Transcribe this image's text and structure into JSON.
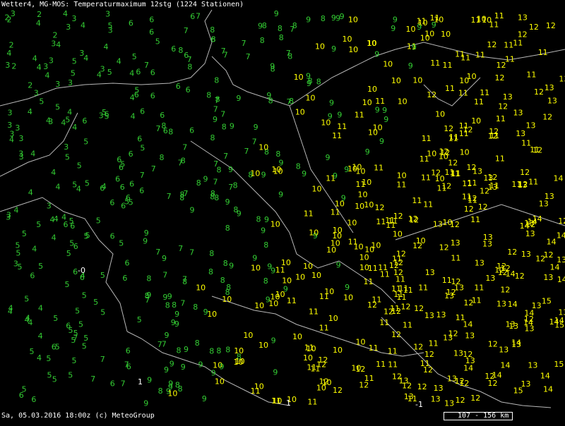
{
  "header": {
    "title": "Wetter4, MG-MOS: Temperaturmaximum 12stg (1224 Stationen)"
  },
  "footer": {
    "timestamp": "Sa, 05.03.2016 18:00z (c) MeteoGroup"
  },
  "scale": {
    "label": "107 - 156 km"
  },
  "colors": {
    "background": "#000000",
    "border": "#b8b8b8",
    "cool": "#33cc33",
    "warm": "#ffff00",
    "text": "#ffffff"
  },
  "stations_sample": [
    {
      "v": "5",
      "c": "g"
    },
    {
      "v": "6",
      "c": "g"
    },
    {
      "v": "5",
      "c": "g"
    },
    {
      "v": "4",
      "c": "g"
    },
    {
      "v": "5",
      "c": "g"
    },
    {
      "v": "6",
      "c": "g"
    },
    {
      "v": "7",
      "c": "g"
    },
    {
      "v": "8",
      "c": "g"
    },
    {
      "v": "9",
      "c": "g"
    },
    {
      "v": "10",
      "c": "y"
    },
    {
      "v": "11",
      "c": "y"
    },
    {
      "v": "12",
      "c": "y"
    },
    {
      "v": "13",
      "c": "y"
    },
    {
      "v": "14",
      "c": "y"
    },
    {
      "v": "-0",
      "c": "w"
    },
    {
      "v": "-1",
      "c": "w"
    },
    {
      "v": "2",
      "c": "g"
    },
    {
      "v": "3",
      "c": "g"
    }
  ]
}
